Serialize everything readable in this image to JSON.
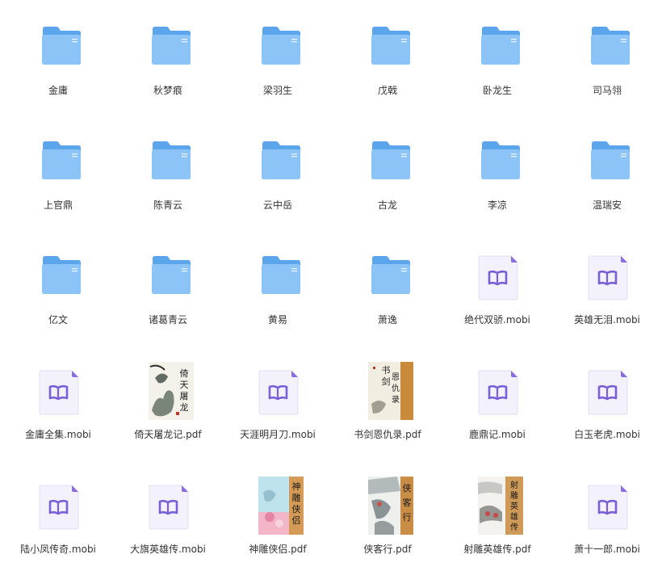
{
  "items": [
    {
      "kind": "folder",
      "label": "金庸"
    },
    {
      "kind": "folder",
      "label": "秋梦痕"
    },
    {
      "kind": "folder",
      "label": "梁羽生"
    },
    {
      "kind": "folder",
      "label": "戊戟"
    },
    {
      "kind": "folder",
      "label": "卧龙生"
    },
    {
      "kind": "folder",
      "label": "司马翎"
    },
    {
      "kind": "folder",
      "label": "上官鼎"
    },
    {
      "kind": "folder",
      "label": "陈青云"
    },
    {
      "kind": "folder",
      "label": "云中岳"
    },
    {
      "kind": "folder",
      "label": "古龙"
    },
    {
      "kind": "folder",
      "label": "李凉"
    },
    {
      "kind": "folder",
      "label": "温瑞安"
    },
    {
      "kind": "folder",
      "label": "亿文"
    },
    {
      "kind": "folder",
      "label": "诸葛青云"
    },
    {
      "kind": "folder",
      "label": "黄易"
    },
    {
      "kind": "folder",
      "label": "萧逸"
    },
    {
      "kind": "mobi",
      "label": "绝代双骄.mobi"
    },
    {
      "kind": "mobi",
      "label": "英雄无泪.mobi"
    },
    {
      "kind": "mobi",
      "label": "金庸全集.mobi"
    },
    {
      "kind": "pdf",
      "label": "倚天屠龙记.pdf",
      "cover_style": "yitian"
    },
    {
      "kind": "mobi",
      "label": "天涯明月刀.mobi"
    },
    {
      "kind": "pdf",
      "label": "书剑恩仇录.pdf",
      "cover_style": "shujian"
    },
    {
      "kind": "mobi",
      "label": "鹿鼎记.mobi"
    },
    {
      "kind": "mobi",
      "label": "白玉老虎.mobi"
    },
    {
      "kind": "mobi",
      "label": "陆小凤传奇.mobi"
    },
    {
      "kind": "mobi",
      "label": "大旗英雄传.mobi"
    },
    {
      "kind": "pdf",
      "label": "神雕侠侣.pdf",
      "cover_style": "shendiao"
    },
    {
      "kind": "pdf",
      "label": "侠客行.pdf",
      "cover_style": "xiake"
    },
    {
      "kind": "pdf",
      "label": "射雕英雄传.pdf",
      "cover_style": "shediao"
    },
    {
      "kind": "mobi",
      "label": "萧十一郎.mobi"
    }
  ],
  "colors": {
    "folder_back": "#5aa5ec",
    "folder_front": "#8cc4f7",
    "doc_bg": "#f3f1fb",
    "doc_border": "#e2def2",
    "doc_fold": "#8b6be0",
    "doc_book": "#7a5fd6",
    "label_text": "#333333"
  }
}
